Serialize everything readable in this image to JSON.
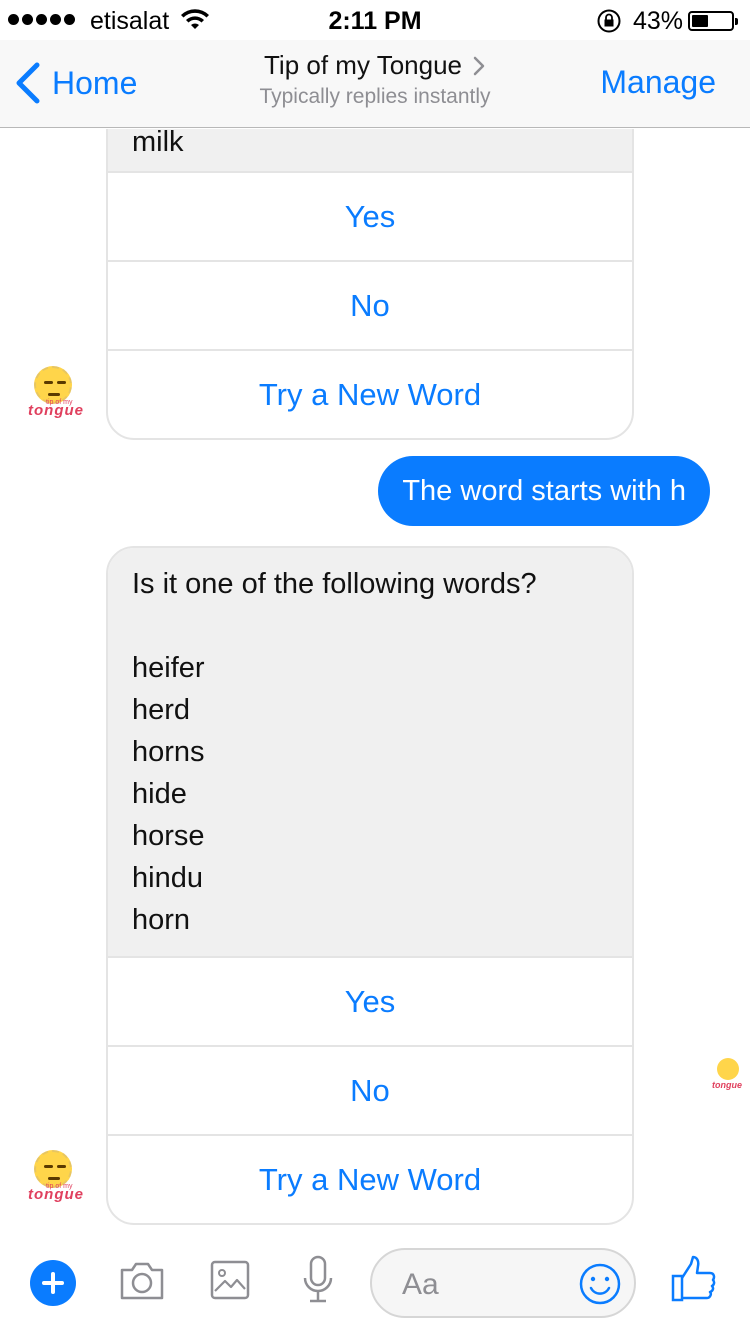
{
  "status_bar": {
    "carrier": "etisalat",
    "time": "2:11 PM",
    "battery_percent": "43%",
    "battery_level": 0.43
  },
  "nav": {
    "back_label": "Home",
    "title": "Tip of my Tongue",
    "subtitle": "Typically replies instantly",
    "manage_label": "Manage"
  },
  "messages": {
    "card1": {
      "text_fragment": "milk",
      "buttons": [
        "Yes",
        "No",
        "Try a New Word"
      ]
    },
    "user_message": "The word starts with h",
    "card2": {
      "question": "Is it one of the following words?",
      "words": [
        "heifer",
        "herd",
        "horns",
        "hide",
        "horse",
        "hindu",
        "horn"
      ],
      "buttons": [
        "Yes",
        "No",
        "Try a New Word"
      ]
    },
    "avatar_brand": "tongue",
    "avatar_brand_small": "tip of my",
    "read_receipt_brand": "tongue"
  },
  "composer": {
    "placeholder": "Aa",
    "icons": [
      "plus-icon",
      "camera-icon",
      "image-icon",
      "microphone-icon",
      "emoji-icon",
      "thumbs-up-icon"
    ]
  },
  "colors": {
    "accent": "#0a7cff",
    "bubble_gray": "#f0f0f0",
    "brand_pink": "#e0405e",
    "avatar_yellow": "#ffd54a"
  }
}
